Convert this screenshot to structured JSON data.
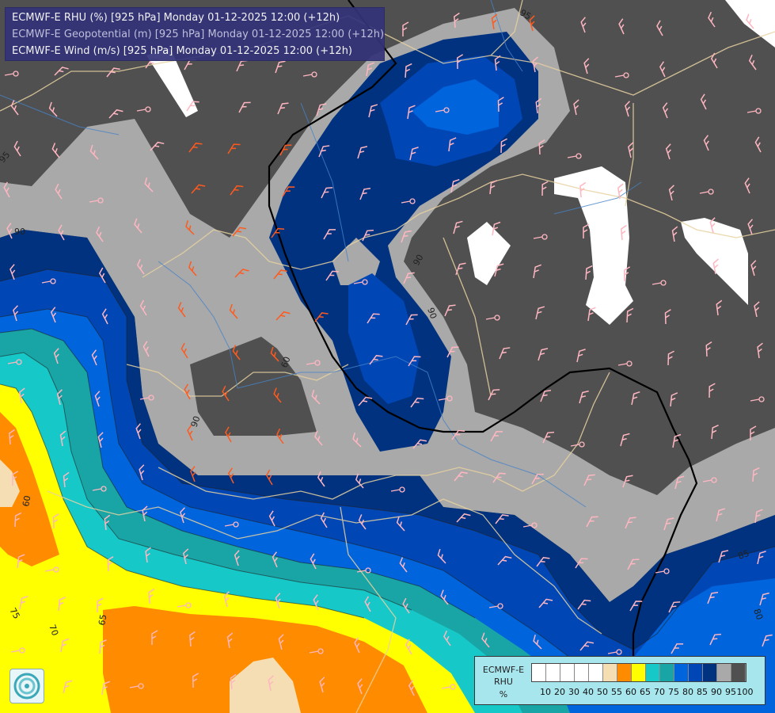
{
  "titles": [
    "ECMWF-E RHU (%) [925 hPa] Monday 01-12-2025 12:00 (+12h)",
    "ECMWF-E Geopotential (m) [925 hPa] Monday 01-12-2025 12:00 (+12h)",
    "ECMWF-E Wind (m/s) [925 hPa] Monday 01-12-2025 12:00 (+12h)"
  ],
  "legend": {
    "line1": "ECMWF-E",
    "line2": "RHU",
    "unit": "%",
    "swatches": [
      "#ffffff",
      "#ffffff",
      "#ffffff",
      "#ffffff",
      "#ffffff",
      "#f5deb3",
      "#ff8c00",
      "#ffff00",
      "#17c8c8",
      "#19a5a5",
      "#0064dc",
      "#0046b4",
      "#003280",
      "#a9a9a9",
      "#505050"
    ],
    "ticks": [
      "10",
      "20",
      "30",
      "40",
      "50",
      "55",
      "60",
      "65",
      "70",
      "75",
      "80",
      "85",
      "90",
      "95",
      "100"
    ]
  },
  "contour_labels": [
    "95",
    "95",
    "90",
    "90",
    "90",
    "85",
    "80",
    "75",
    "70",
    "65",
    "60",
    "60",
    "90"
  ],
  "icons": {
    "logo": "ecmwf-logo-icon",
    "wind_barb": "wind-barb-icon",
    "calm_marker": "calm-circle-icon"
  },
  "colors": {
    "rh_100": "#505050",
    "rh_95": "#a9a9a9",
    "rh_90": "#003280",
    "rh_85": "#0046b4",
    "rh_80": "#0064dc",
    "rh_75": "#19a5a5",
    "rh_70": "#17c8c8",
    "rh_65": "#ffff00",
    "rh_60": "#ff8c00",
    "rh_55": "#f5deb3",
    "rh_low": "#ffffff",
    "barb_pink": "#ffb6c1",
    "barb_orange": "#ff5a1e",
    "geopotential_line": "#000000",
    "border_line": "#e8d2a0",
    "river_line": "#4682c8"
  }
}
